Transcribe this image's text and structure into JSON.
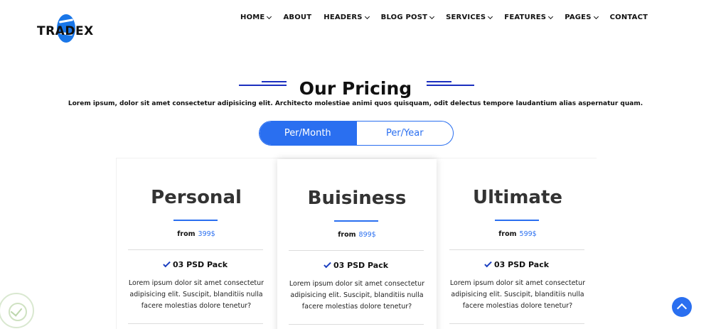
{
  "header": {
    "logo_text": "TRADEX",
    "nav": [
      {
        "label": "HOME",
        "has_dropdown": true
      },
      {
        "label": "ABOUT",
        "has_dropdown": false
      },
      {
        "label": "HEADERS",
        "has_dropdown": true
      },
      {
        "label": "BLOG POST",
        "has_dropdown": true
      },
      {
        "label": "SERVICES",
        "has_dropdown": true
      },
      {
        "label": "FEATURES",
        "has_dropdown": true
      },
      {
        "label": "PAGES",
        "has_dropdown": true
      },
      {
        "label": "CONTACT",
        "has_dropdown": false
      }
    ]
  },
  "pricing": {
    "title": "Our Pricing",
    "subtitle": "Lorem ipsum, dolor sit amet consectetur adipisicing elit. Architecto molestiae animi quos quisquam, odit delectus tempore laudantium alias aspernatur quam.",
    "toggle": {
      "monthly_label": "Per/Month",
      "yearly_label": "Per/Year",
      "selected": "Per/Month"
    },
    "plans": [
      {
        "name": "Personal",
        "price_prefix": "from",
        "price": "399$",
        "feature": "03 PSD Pack",
        "description": "Lorem ipsum dolor sit amet consectetur adipisicing elit. Suscipit, blanditiis nulla facere molestias dolore tenetur?"
      },
      {
        "name": "Buisiness",
        "price_prefix": "from",
        "price": "899$",
        "feature": "03 PSD Pack",
        "description": "Lorem ipsum dolor sit amet consectetur adipisicing elit. Suscipit, blanditiis nulla facere molestias dolore tenetur?"
      },
      {
        "name": "Ultimate",
        "price_prefix": "from",
        "price": "599$",
        "feature": "03 PSD Pack",
        "description": "Lorem ipsum dolor sit amet consectetur adipisicing elit. Suscipit, blanditiis nulla facere molestias dolore tenetur?"
      }
    ]
  },
  "colors": {
    "accent": "#2a6ff0",
    "title_decoration": "#1b2fbf",
    "text": "#111111"
  },
  "icons": {
    "nav_dropdown": "chevron-down-icon",
    "feature": "check-icon",
    "scroll_top": "chevron-up-icon",
    "corner_badge": "shield-badge-icon"
  }
}
